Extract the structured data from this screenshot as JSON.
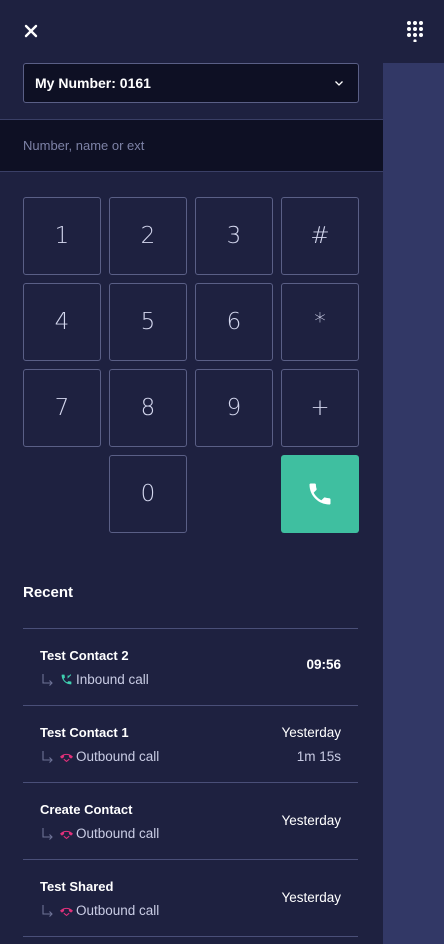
{
  "header": {
    "close_icon": "close-icon",
    "dialpad_icon": "dialpad-icon"
  },
  "number_select": {
    "label": "My Number: 0161",
    "icon": "chevron-down-icon"
  },
  "search": {
    "placeholder": "Number, name or ext",
    "value": ""
  },
  "keypad": {
    "keys": [
      "1",
      "2",
      "3",
      "#",
      "4",
      "5",
      "6",
      "*",
      "7",
      "8",
      "9",
      "+",
      "0"
    ],
    "call_icon": "phone-icon"
  },
  "recent": {
    "title": "Recent",
    "items": [
      {
        "name": "Test Contact 2",
        "type": "Inbound call",
        "time": "09:56",
        "duration": "",
        "direction": "inbound"
      },
      {
        "name": "Test Contact 1",
        "type": "Outbound call",
        "time": "Yesterday",
        "duration": "1m 15s",
        "direction": "outbound"
      },
      {
        "name": "Create Contact",
        "type": "Outbound call",
        "time": "Yesterday",
        "duration": "",
        "direction": "outbound"
      },
      {
        "name": "Test Shared",
        "type": "Outbound call",
        "time": "Yesterday",
        "duration": "",
        "direction": "outbound"
      }
    ]
  },
  "colors": {
    "background": "#1e2140",
    "input_background": "#0e1024",
    "side_strip": "#323866",
    "call_button": "#3fbfa0",
    "inbound_icon": "#3fd0b0",
    "outbound_icon": "#e0307a"
  }
}
